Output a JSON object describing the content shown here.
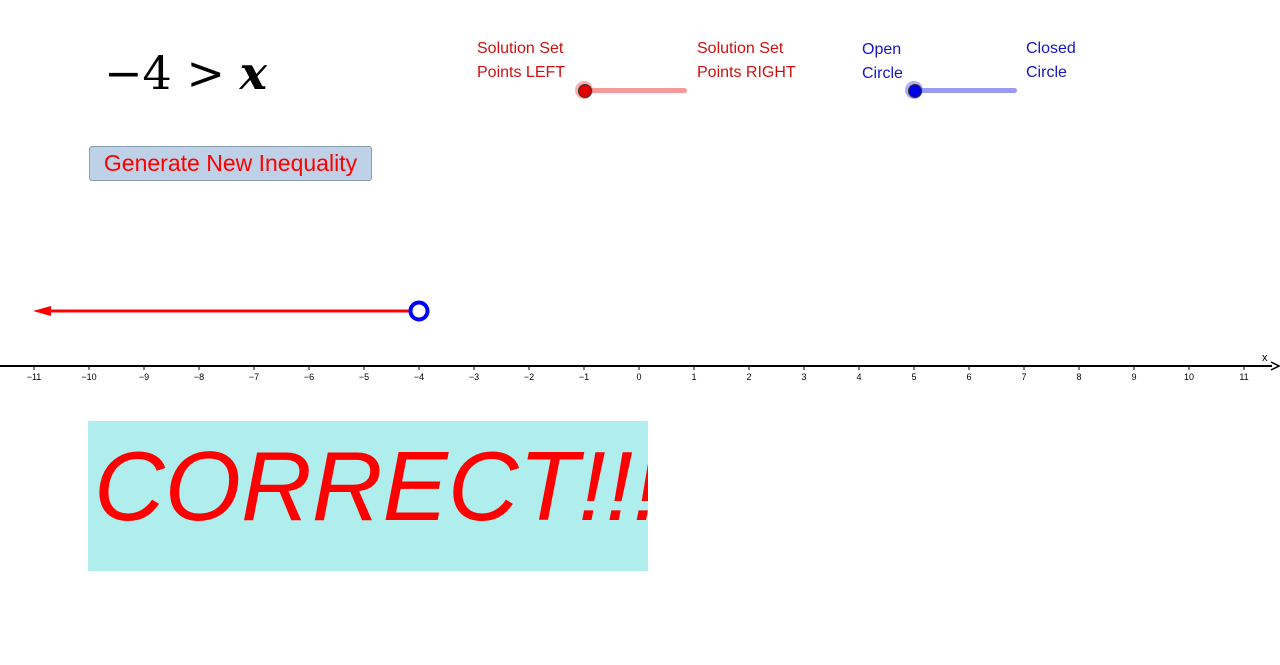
{
  "inequality": {
    "left": "−4",
    "op": ">",
    "var": "x"
  },
  "generate_button": "Generate New Inequality",
  "direction_slider": {
    "min_label_1": "Solution Set",
    "min_label_2": "Points LEFT",
    "max_label_1": "Solution Set",
    "max_label_2": "Points RIGHT",
    "value": 0,
    "color": "#f56060"
  },
  "circle_slider": {
    "min_label_1": "Open",
    "min_label_2": "Circle",
    "max_label_1": "Closed",
    "max_label_2": "Circle",
    "value": 0,
    "color": "#6060f5"
  },
  "number_line": {
    "axis_label": "x",
    "xmin": -11,
    "xmax": 11,
    "ticks": [
      "−11",
      "−10",
      "−9",
      "−8",
      "−7",
      "−6",
      "−5",
      "−4",
      "−3",
      "−2",
      "−1",
      "0",
      "1",
      "2",
      "3",
      "4",
      "5",
      "6",
      "7",
      "8",
      "9",
      "10",
      "11"
    ],
    "solution": {
      "endpoint": -4,
      "direction": "left",
      "endpoint_style": "open",
      "ray_color": "#ff0000",
      "circle_color": "#0000ff"
    }
  },
  "feedback": "CORRECT!!!"
}
